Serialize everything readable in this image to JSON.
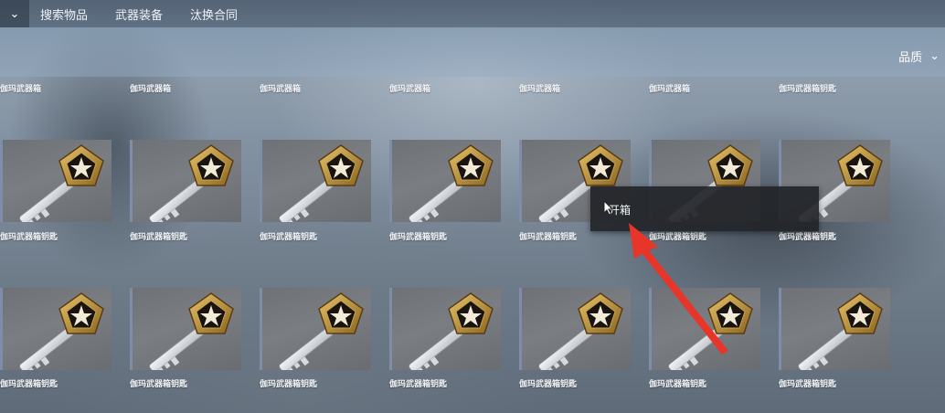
{
  "topbar": {
    "collapse_icon": "chevron-down-icon",
    "tabs": [
      "搜索物品",
      "武器装备",
      "汰换合同"
    ]
  },
  "sort": {
    "label": "品质",
    "icon": "chevron-down-icon"
  },
  "row0_labels": [
    "伽玛武器箱",
    "伽玛武器箱",
    "伽玛武器箱",
    "伽玛武器箱",
    "伽玛武器箱",
    "伽玛武器箱",
    "伽玛武器箱钥匙"
  ],
  "row1_labels": [
    "伽玛武器箱钥匙",
    "伽玛武器箱钥匙",
    "伽玛武器箱钥匙",
    "伽玛武器箱钥匙",
    "伽玛武器箱钥匙",
    "伽玛武器箱钥匙",
    "伽玛武器箱钥匙"
  ],
  "row2_labels": [
    "伽玛武器箱钥匙",
    "伽玛武器箱钥匙",
    "伽玛武器箱钥匙",
    "伽玛武器箱钥匙",
    "伽玛武器箱钥匙",
    "伽玛武器箱钥匙",
    "伽玛武器箱钥匙"
  ],
  "context_menu": {
    "open_case": "开箱"
  },
  "colors": {
    "annotation_arrow": "#e8352a",
    "menu_bg": "#222428",
    "tile_bg": "#74787d"
  }
}
